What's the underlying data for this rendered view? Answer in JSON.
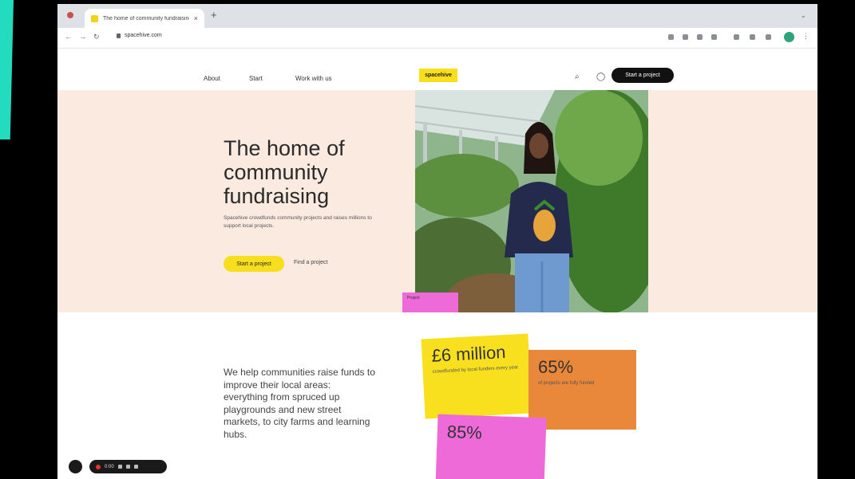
{
  "browser": {
    "tab_title": "The home of community fundraising",
    "tab_close": "×",
    "new_tab": "+",
    "url": "spacehive.com",
    "back": "←",
    "forward": "→",
    "reload": "↻",
    "menu": "⋮"
  },
  "site": {
    "logo": "spacehive",
    "nav": [
      "About",
      "Start",
      "Work with us"
    ],
    "start_project_label": "Start a project"
  },
  "hero": {
    "title": "The home of community fundraising",
    "subtitle": "Spacehive crowdfunds community projects and raises millions to support local projects.",
    "primary_cta": "Start a project",
    "secondary_cta": "Find a project",
    "photo_tag": "Project"
  },
  "section": {
    "description": "We help communities raise funds to improve their local areas: everything from spruced up playgrounds and new street markets, to city farms and learning hubs.",
    "stats": [
      {
        "big": "£6 million",
        "small": "crowdfunded by local funders every year"
      },
      {
        "big": "65%",
        "small": "of projects are fully funded"
      },
      {
        "big": "85%",
        "small": ""
      }
    ]
  },
  "recorder": {
    "time": "0:00"
  },
  "colors": {
    "accent_yellow": "#f7df1e",
    "hero_bg": "#fbeae0",
    "orange": "#e9883a",
    "pink": "#ee6ad8",
    "teal": "#23dcc0"
  }
}
